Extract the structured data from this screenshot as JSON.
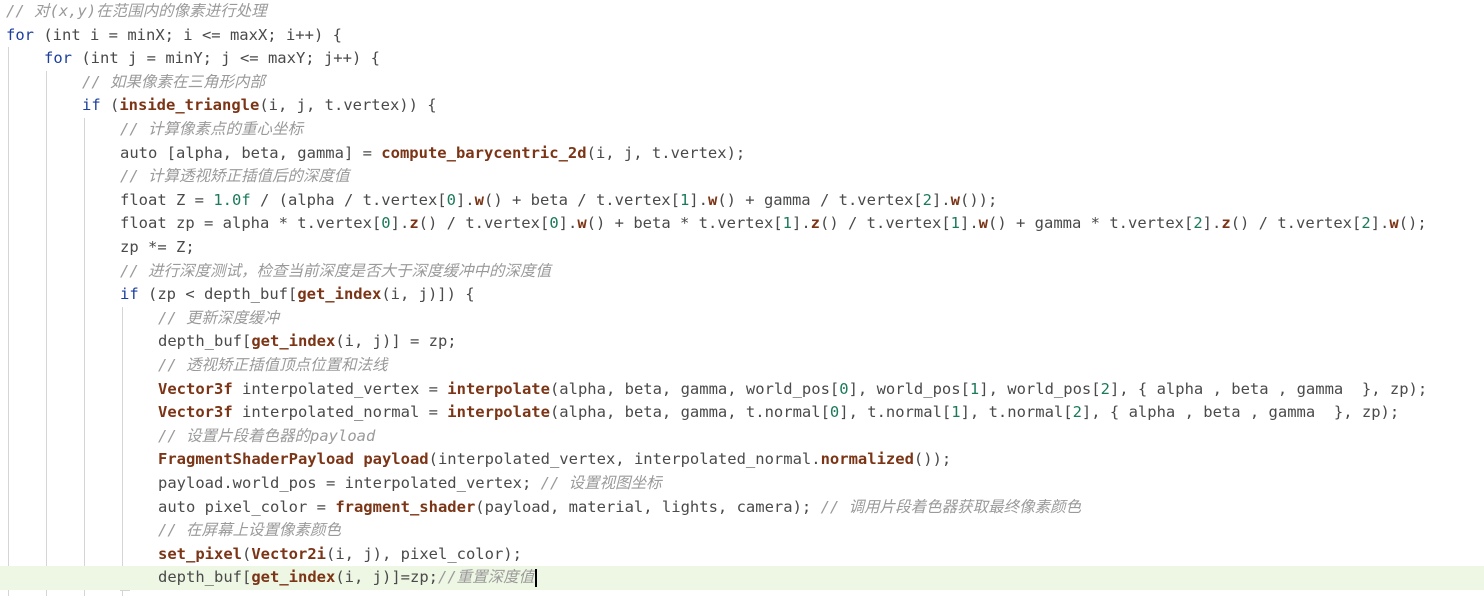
{
  "theme": {
    "background": "#ffffff",
    "active_line_background": "#eef6e4",
    "indent_guide": "#d5d5d5",
    "keyword": "#1b3f9e",
    "plain": "#4a4a4a",
    "function": "#7b3516",
    "type": "#7b3516",
    "number": "#1b7a5a",
    "comment": "#9a9a9a"
  },
  "code": {
    "active_line": 24,
    "lines": [
      {
        "indent": 0,
        "segments": [
          {
            "t": "// 对(x,y)在范围内的像素进行处理",
            "k": "cm"
          }
        ]
      },
      {
        "indent": 0,
        "segments": [
          {
            "t": "for",
            "k": "kw"
          },
          {
            "t": " (int i = minX; i <= maxX; i++) {",
            "k": "plain"
          }
        ]
      },
      {
        "indent": 1,
        "segments": [
          {
            "t": "for",
            "k": "kw"
          },
          {
            "t": " (int j = minY; j <= maxY; j++) {",
            "k": "plain"
          }
        ]
      },
      {
        "indent": 2,
        "segments": [
          {
            "t": "// 如果像素在三角形内部",
            "k": "cm"
          }
        ]
      },
      {
        "indent": 2,
        "segments": [
          {
            "t": "if",
            "k": "kw"
          },
          {
            "t": " (",
            "k": "plain"
          },
          {
            "t": "inside_triangle",
            "k": "fn"
          },
          {
            "t": "(i, j, t.vertex)) {",
            "k": "plain"
          }
        ]
      },
      {
        "indent": 3,
        "segments": [
          {
            "t": "// 计算像素点的重心坐标",
            "k": "cm"
          }
        ]
      },
      {
        "indent": 3,
        "segments": [
          {
            "t": "auto [alpha, beta, gamma] = ",
            "k": "plain"
          },
          {
            "t": "compute_barycentric_2d",
            "k": "fn"
          },
          {
            "t": "(i, j, t.vertex);",
            "k": "plain"
          }
        ]
      },
      {
        "indent": 3,
        "segments": [
          {
            "t": "// 计算透视矫正插值后的深度值",
            "k": "cm"
          }
        ]
      },
      {
        "indent": 3,
        "segments": [
          {
            "t": "float Z = ",
            "k": "plain"
          },
          {
            "t": "1.0f",
            "k": "num"
          },
          {
            "t": " / (alpha / t.vertex[",
            "k": "plain"
          },
          {
            "t": "0",
            "k": "num"
          },
          {
            "t": "].",
            "k": "plain"
          },
          {
            "t": "w",
            "k": "fn"
          },
          {
            "t": "() + beta / t.vertex[",
            "k": "plain"
          },
          {
            "t": "1",
            "k": "num"
          },
          {
            "t": "].",
            "k": "plain"
          },
          {
            "t": "w",
            "k": "fn"
          },
          {
            "t": "() + gamma / t.vertex[",
            "k": "plain"
          },
          {
            "t": "2",
            "k": "num"
          },
          {
            "t": "].",
            "k": "plain"
          },
          {
            "t": "w",
            "k": "fn"
          },
          {
            "t": "());",
            "k": "plain"
          }
        ]
      },
      {
        "indent": 3,
        "segments": [
          {
            "t": "float zp = alpha * t.vertex[",
            "k": "plain"
          },
          {
            "t": "0",
            "k": "num"
          },
          {
            "t": "].",
            "k": "plain"
          },
          {
            "t": "z",
            "k": "fn"
          },
          {
            "t": "() / t.vertex[",
            "k": "plain"
          },
          {
            "t": "0",
            "k": "num"
          },
          {
            "t": "].",
            "k": "plain"
          },
          {
            "t": "w",
            "k": "fn"
          },
          {
            "t": "() + beta * t.vertex[",
            "k": "plain"
          },
          {
            "t": "1",
            "k": "num"
          },
          {
            "t": "].",
            "k": "plain"
          },
          {
            "t": "z",
            "k": "fn"
          },
          {
            "t": "() / t.vertex[",
            "k": "plain"
          },
          {
            "t": "1",
            "k": "num"
          },
          {
            "t": "].",
            "k": "plain"
          },
          {
            "t": "w",
            "k": "fn"
          },
          {
            "t": "() + gamma * t.vertex[",
            "k": "plain"
          },
          {
            "t": "2",
            "k": "num"
          },
          {
            "t": "].",
            "k": "plain"
          },
          {
            "t": "z",
            "k": "fn"
          },
          {
            "t": "() / t.vertex[",
            "k": "plain"
          },
          {
            "t": "2",
            "k": "num"
          },
          {
            "t": "].",
            "k": "plain"
          },
          {
            "t": "w",
            "k": "fn"
          },
          {
            "t": "();",
            "k": "plain"
          }
        ]
      },
      {
        "indent": 3,
        "segments": [
          {
            "t": "zp *= Z;",
            "k": "plain"
          }
        ]
      },
      {
        "indent": 3,
        "segments": [
          {
            "t": "// 进行深度测试，检查当前深度是否大于深度缓冲中的深度值",
            "k": "cm"
          }
        ]
      },
      {
        "indent": 3,
        "segments": [
          {
            "t": "if",
            "k": "kw"
          },
          {
            "t": " (zp < depth_buf[",
            "k": "plain"
          },
          {
            "t": "get_index",
            "k": "fn"
          },
          {
            "t": "(i, j)]) {",
            "k": "plain"
          }
        ]
      },
      {
        "indent": 4,
        "segments": [
          {
            "t": "// 更新深度缓冲",
            "k": "cm"
          }
        ]
      },
      {
        "indent": 4,
        "segments": [
          {
            "t": "depth_buf[",
            "k": "plain"
          },
          {
            "t": "get_index",
            "k": "fn"
          },
          {
            "t": "(i, j)] = zp;",
            "k": "plain"
          }
        ]
      },
      {
        "indent": 4,
        "segments": [
          {
            "t": "// 透视矫正插值顶点位置和法线",
            "k": "cm"
          }
        ]
      },
      {
        "indent": 4,
        "segments": [
          {
            "t": "Vector3f",
            "k": "type"
          },
          {
            "t": " interpolated_vertex = ",
            "k": "plain"
          },
          {
            "t": "interpolate",
            "k": "fn"
          },
          {
            "t": "(alpha, beta, gamma, world_pos[",
            "k": "plain"
          },
          {
            "t": "0",
            "k": "num"
          },
          {
            "t": "], world_pos[",
            "k": "plain"
          },
          {
            "t": "1",
            "k": "num"
          },
          {
            "t": "], world_pos[",
            "k": "plain"
          },
          {
            "t": "2",
            "k": "num"
          },
          {
            "t": "], { alpha , beta , gamma  }, zp);",
            "k": "plain"
          }
        ]
      },
      {
        "indent": 4,
        "segments": [
          {
            "t": "Vector3f",
            "k": "type"
          },
          {
            "t": " interpolated_normal = ",
            "k": "plain"
          },
          {
            "t": "interpolate",
            "k": "fn"
          },
          {
            "t": "(alpha, beta, gamma, t.normal[",
            "k": "plain"
          },
          {
            "t": "0",
            "k": "num"
          },
          {
            "t": "], t.normal[",
            "k": "plain"
          },
          {
            "t": "1",
            "k": "num"
          },
          {
            "t": "], t.normal[",
            "k": "plain"
          },
          {
            "t": "2",
            "k": "num"
          },
          {
            "t": "], { alpha , beta , gamma  }, zp);",
            "k": "plain"
          }
        ]
      },
      {
        "indent": 4,
        "segments": [
          {
            "t": "// 设置片段着色器的payload",
            "k": "cm"
          }
        ]
      },
      {
        "indent": 4,
        "segments": [
          {
            "t": "FragmentShaderPayload",
            "k": "type"
          },
          {
            "t": " ",
            "k": "plain"
          },
          {
            "t": "payload",
            "k": "fn"
          },
          {
            "t": "(interpolated_vertex, interpolated_normal.",
            "k": "plain"
          },
          {
            "t": "normalized",
            "k": "fn"
          },
          {
            "t": "());",
            "k": "plain"
          }
        ]
      },
      {
        "indent": 4,
        "segments": [
          {
            "t": "payload.world_pos = interpolated_vertex; ",
            "k": "plain"
          },
          {
            "t": "// 设置视图坐标",
            "k": "cm"
          }
        ]
      },
      {
        "indent": 4,
        "segments": [
          {
            "t": "auto pixel_color = ",
            "k": "plain"
          },
          {
            "t": "fragment_shader",
            "k": "fn"
          },
          {
            "t": "(payload, material, lights, camera); ",
            "k": "plain"
          },
          {
            "t": "// 调用片段着色器获取最终像素颜色",
            "k": "cm"
          }
        ]
      },
      {
        "indent": 4,
        "segments": [
          {
            "t": "// 在屏幕上设置像素颜色",
            "k": "cm"
          }
        ]
      },
      {
        "indent": 4,
        "segments": [
          {
            "t": "set_pixel",
            "k": "fn"
          },
          {
            "t": "(",
            "k": "plain"
          },
          {
            "t": "Vector2i",
            "k": "type"
          },
          {
            "t": "(i, j), pixel_color);",
            "k": "plain"
          }
        ]
      },
      {
        "indent": 4,
        "segments": [
          {
            "t": "depth_buf[",
            "k": "plain"
          },
          {
            "t": "get_index",
            "k": "fn"
          },
          {
            "t": "(i, j)]=zp;",
            "k": "plain"
          },
          {
            "t": "//重置深度值",
            "k": "cm"
          }
        ]
      }
    ]
  }
}
